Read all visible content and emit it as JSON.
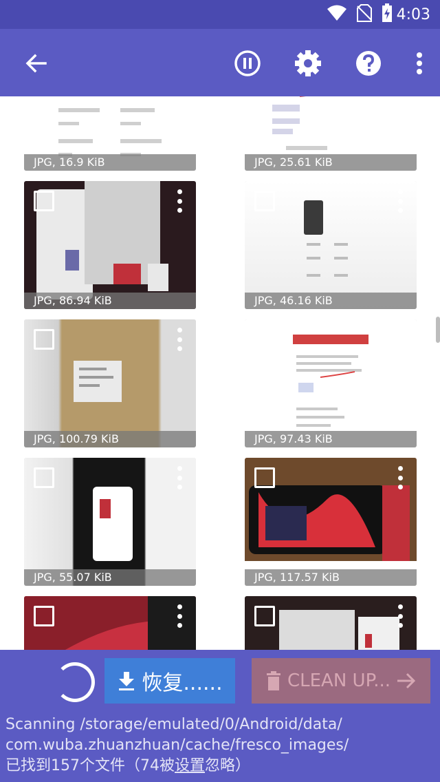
{
  "statusbar": {
    "time": "4:03",
    "icons": [
      "wifi-icon",
      "no-sim-icon",
      "battery-charging-icon"
    ]
  },
  "appbar": {
    "icons": [
      "back-arrow-icon",
      "pause-icon",
      "gear-icon",
      "help-icon",
      "overflow-menu-icon"
    ]
  },
  "files": [
    {
      "caption": "JPG, 16.9 KiB"
    },
    {
      "caption": "JPG, 25.61 KiB"
    },
    {
      "caption": "JPG, 86.94 KiB"
    },
    {
      "caption": "JPG, 46.16 KiB"
    },
    {
      "caption": "JPG, 100.79 KiB"
    },
    {
      "caption": "JPG, 97.43 KiB"
    },
    {
      "caption": "JPG, 55.07 KiB"
    },
    {
      "caption": "JPG, 117.57 KiB"
    },
    {
      "caption": ""
    },
    {
      "caption": ""
    }
  ],
  "actions": {
    "restore_label": "恢复......",
    "clean_label": "CLEAN UP..."
  },
  "status": {
    "line1": "Scanning /storage/emulated/0/Android/data/",
    "line2": "com.wuba.zhuanzhuan/cache/fresco_images/",
    "line3_prefix": "已找到157个文件（74被",
    "line3_link": "设置",
    "line3_suffix": "忽略）"
  },
  "colors": {
    "appbar": "#5b5bc3",
    "statusbar": "#4a4ab0",
    "restore_button": "#3f7fd8",
    "clean_button_disabled": "#9b6a80"
  }
}
